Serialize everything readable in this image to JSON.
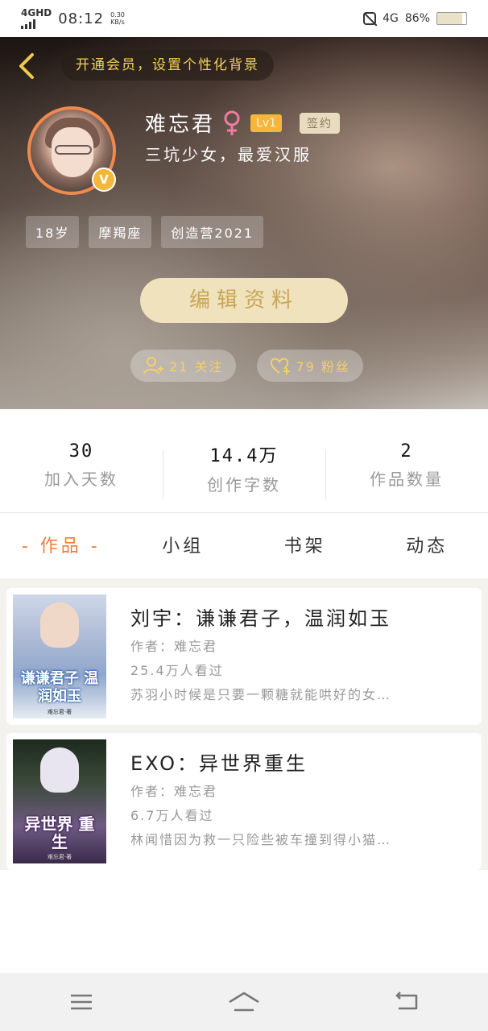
{
  "status_bar": {
    "network": "4GHD",
    "time": "08:12",
    "speed_value": "0.30",
    "speed_unit": "KB/s",
    "right_network": "4G",
    "battery": "86%"
  },
  "header": {
    "vip_banner": "开通会员，设置个性化背景",
    "username": "难忘君",
    "level": "Lv1",
    "signed_badge": "签约",
    "signature": "三坑少女，最爱汉服",
    "tags": [
      "18岁",
      "摩羯座",
      "创造营2021"
    ],
    "edit_button": "编辑资料",
    "following": "21 关注",
    "followers": "79 粉丝",
    "verified_badge": "V"
  },
  "stats": [
    {
      "value": "30",
      "label": "加入天数"
    },
    {
      "value": "14.4万",
      "label": "创作字数"
    },
    {
      "value": "2",
      "label": "作品数量"
    }
  ],
  "tabs": [
    {
      "label": "- 作品 -",
      "active": true
    },
    {
      "label": "小组",
      "active": false
    },
    {
      "label": "书架",
      "active": false
    },
    {
      "label": "动态",
      "active": false
    }
  ],
  "works": [
    {
      "title": "刘宇：谦谦君子，温润如玉",
      "author": "作者：难忘君",
      "views": "25.4万人看过",
      "description": "苏羽小时候是只要一颗糖就能哄好的女…",
      "cover_title": "谦谦君子 温润如玉",
      "cover_author": "难忘君·著"
    },
    {
      "title": "EXO：异世界重生",
      "author": "作者：难忘君",
      "views": "6.7万人看过",
      "description": "林闻惜因为救一只险些被车撞到得小猫…",
      "cover_title": "异世界 重生",
      "cover_author": "难忘君·著"
    }
  ],
  "colors": {
    "accent_orange": "#f07c3a",
    "gold": "#f4d068",
    "edit_button_bg": "#efe2bc"
  }
}
